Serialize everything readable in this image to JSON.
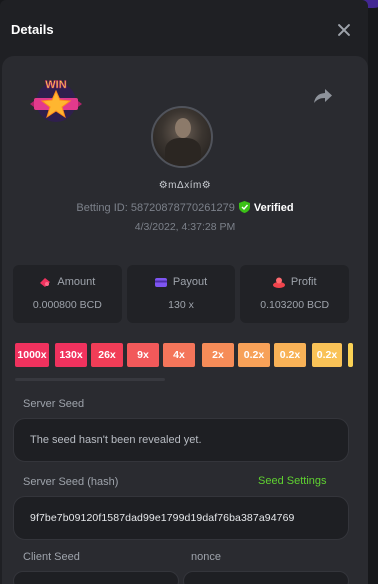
{
  "modal": {
    "title": "Details"
  },
  "user": {
    "name": "⚙mΔxím⚙",
    "betting_id_label": "Betting ID:",
    "betting_id": "58720878770261279",
    "verified_label": "Verified",
    "date": "4/3/2022, 4:37:28 PM"
  },
  "badge": {
    "text": "WIN"
  },
  "stats": [
    {
      "label": "Amount",
      "value": "0.000800 BCD",
      "icon": "amount-icon",
      "color": "#f0325e"
    },
    {
      "label": "Payout",
      "value": "130 x",
      "icon": "payout-icon",
      "color": "#7e55f1"
    },
    {
      "label": "Profit",
      "value": "0.103200 BCD",
      "icon": "profit-icon",
      "color": "#f0444c"
    }
  ],
  "multipliers": [
    {
      "label": "1000x",
      "color": "#f0325e"
    },
    {
      "label": "130x",
      "color": "#f0325e"
    },
    {
      "label": "26x",
      "color": "#f13d57"
    },
    {
      "label": "9x",
      "color": "#f2595a"
    },
    {
      "label": "4x",
      "color": "#f4755a"
    },
    {
      "label": "2x",
      "color": "#f68c58"
    },
    {
      "label": "0.2x",
      "color": "#f7a158"
    },
    {
      "label": "0.2x",
      "color": "#f8b257"
    },
    {
      "label": "0.2x",
      "color": "#f9c257"
    }
  ],
  "server_seed": {
    "label": "Server Seed",
    "value": "The seed hasn't been revealed yet."
  },
  "server_seed_hash": {
    "label": "Server Seed (hash)",
    "link": "Seed Settings",
    "value": "9f7be7b09120f1587dad99e1799d19daf76ba387a94769"
  },
  "client_seed": {
    "label": "Client Seed"
  },
  "nonce": {
    "label": "nonce"
  },
  "colors": {
    "accent_green": "#5fd130",
    "panel": "#2a2b30",
    "verified": "#3bc117"
  }
}
